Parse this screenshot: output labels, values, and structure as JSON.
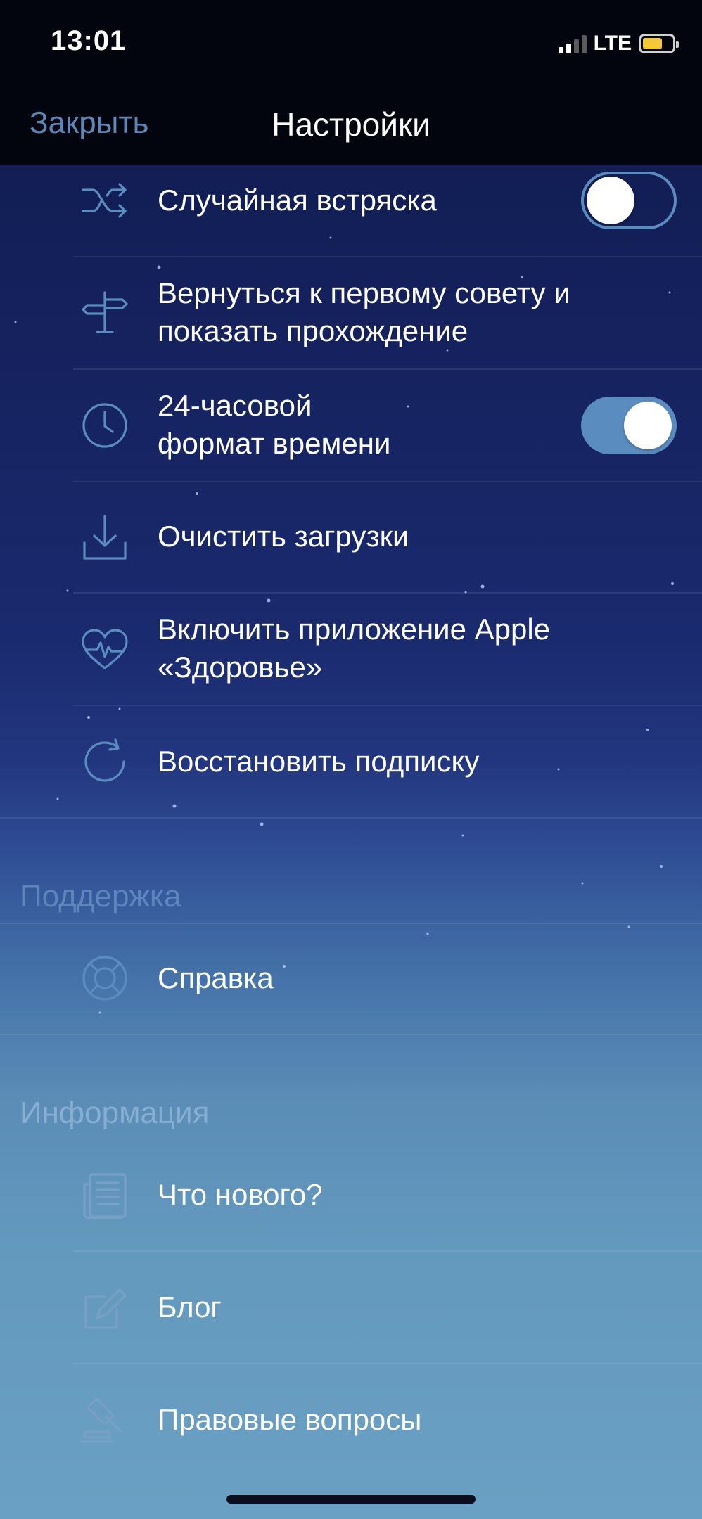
{
  "status": {
    "time": "13:01",
    "network": "LTE",
    "signal_bars_active": 2,
    "signal_bars_total": 4,
    "battery_level": 0.68,
    "battery_color": "#f5c838"
  },
  "nav": {
    "close_label": "Закрыть",
    "title": "Настройки"
  },
  "settings": {
    "items": [
      {
        "label": "Случайная встряска",
        "icon": "shuffle-icon",
        "toggle": false
      },
      {
        "label_line1": "Вернуться к первому совету и",
        "label_line2": "показать прохождение",
        "icon": "signpost-icon"
      },
      {
        "label_line1": "24-часовой",
        "label_line2": "формат времени",
        "icon": "clock-icon",
        "toggle": true
      },
      {
        "label": "Очистить загрузки",
        "icon": "download-icon"
      },
      {
        "label_line1": "Включить приложение Apple",
        "label_line2": "«Здоровье»",
        "icon": "heart-pulse-icon"
      },
      {
        "label": "Восстановить подписку",
        "icon": "restore-icon"
      }
    ]
  },
  "support": {
    "header": "Поддержка",
    "items": [
      {
        "label": "Справка",
        "icon": "lifebuoy-icon"
      }
    ]
  },
  "info": {
    "header": "Информация",
    "items": [
      {
        "label": "Что нового?",
        "icon": "newspaper-icon"
      },
      {
        "label": "Блог",
        "icon": "edit-icon"
      },
      {
        "label": "Правовые вопросы",
        "icon": "gavel-icon"
      }
    ]
  },
  "colors": {
    "accent": "#5b8cc0",
    "nav_background": "#02050d",
    "section_header": "#5d86bd"
  }
}
